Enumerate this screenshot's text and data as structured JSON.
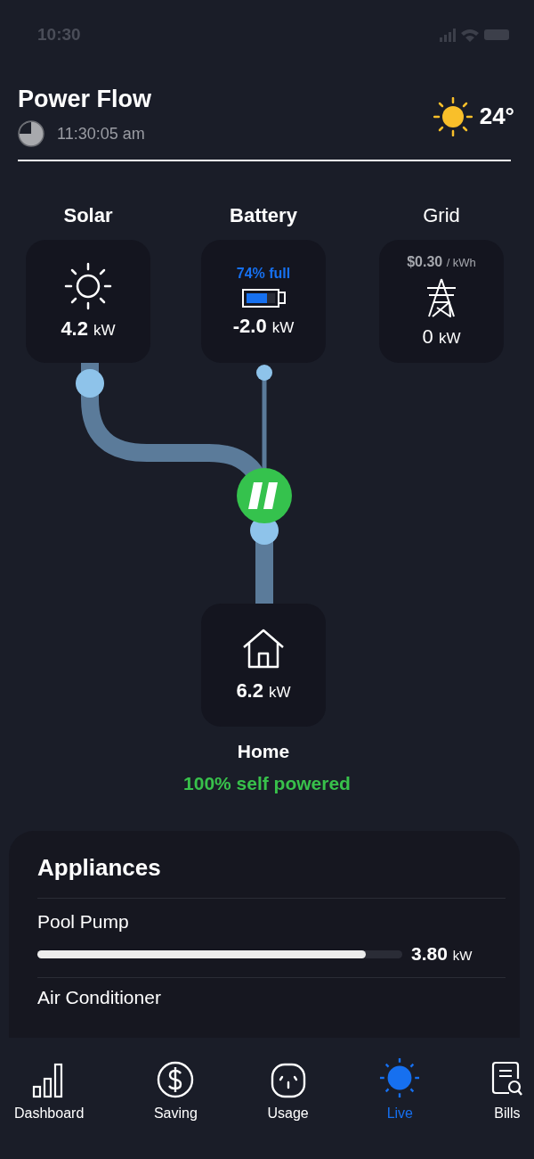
{
  "status_bar": {
    "time": "10:30"
  },
  "header": {
    "title": "Power Flow",
    "time": "11:30:05 am",
    "temperature": "24°"
  },
  "sources": [
    {
      "kind": "solar",
      "label": "Solar",
      "value": "4.2",
      "unit": "kW"
    },
    {
      "kind": "battery",
      "label": "Battery",
      "status": "74% full",
      "level": 0.74,
      "value": "-2.0",
      "unit": "kW"
    },
    {
      "kind": "grid",
      "label": "Grid",
      "price": "$0.30",
      "price_unit": "/ kWh",
      "value": "0",
      "unit": "kW"
    }
  ],
  "home": {
    "value": "6.2",
    "unit": "kW",
    "label": "Home",
    "status": "100% self powered"
  },
  "appliances": {
    "title": "Appliances",
    "items": [
      {
        "name": "Pool Pump",
        "level": 0.9,
        "value": "3.80",
        "unit": "kW"
      },
      {
        "name": "Air Conditioner"
      }
    ]
  },
  "tabs": [
    {
      "kind": "dashboard",
      "label": "Dashboard",
      "selected": false
    },
    {
      "kind": "saving",
      "label": "Saving",
      "selected": false
    },
    {
      "kind": "usage",
      "label": "Usage",
      "selected": false
    },
    {
      "kind": "live",
      "label": "Live",
      "selected": true
    },
    {
      "kind": "bills",
      "label": "Bills",
      "selected": false
    }
  ]
}
